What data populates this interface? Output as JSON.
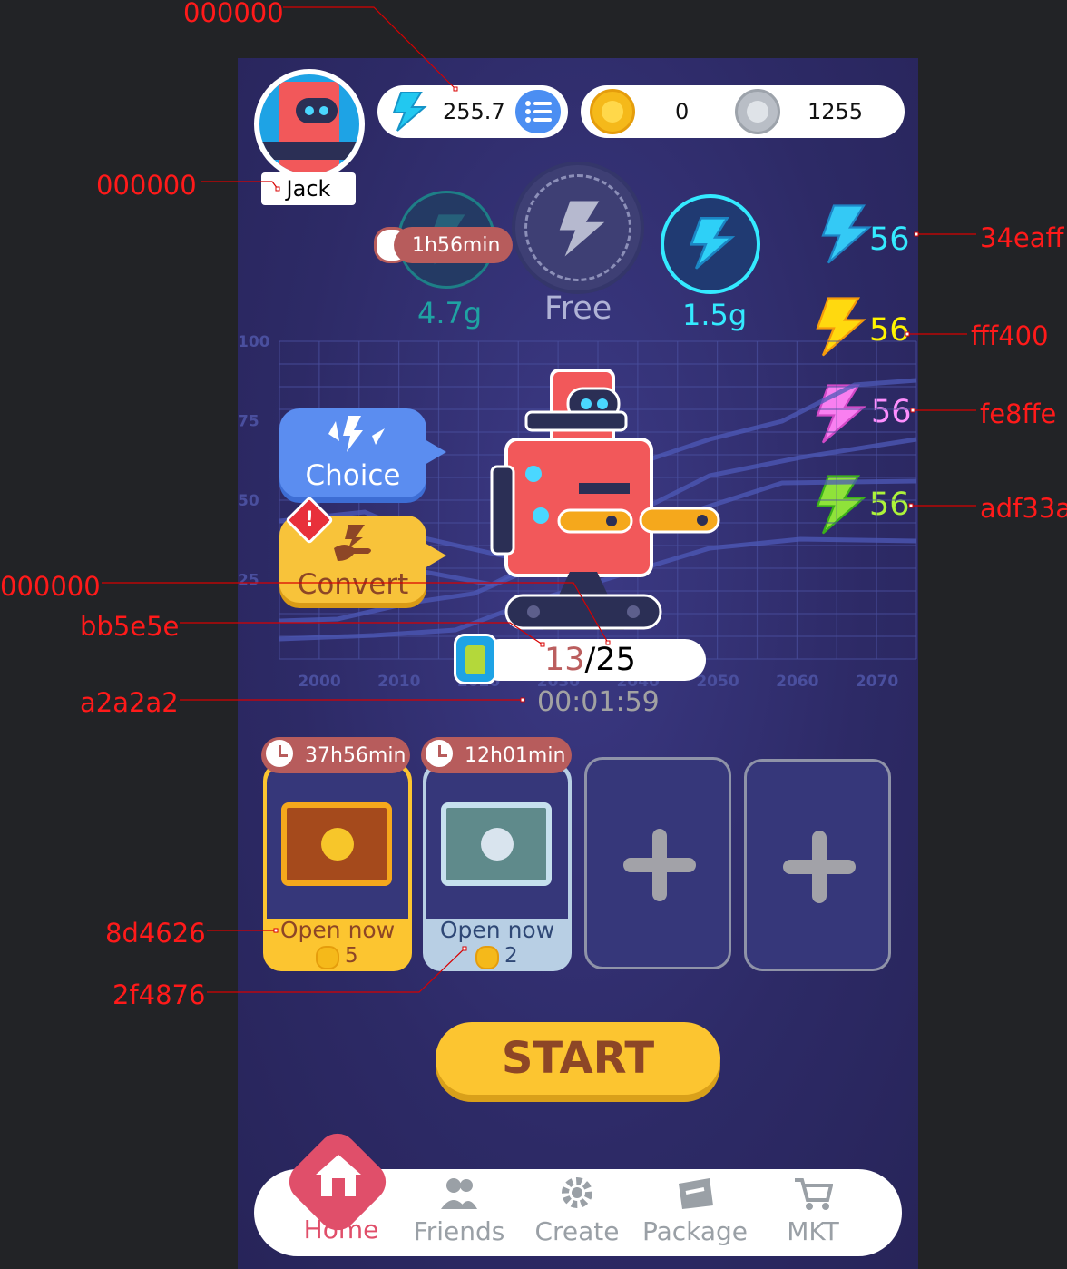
{
  "profile": {
    "name": "Jack"
  },
  "resources": {
    "energy": "255.7",
    "gold": "0",
    "silver": "1255"
  },
  "modes": [
    {
      "label": "4.7g",
      "timer": "1h56min",
      "color": "#1fa3a3"
    },
    {
      "label": "Free",
      "color": "#b0b3d6"
    },
    {
      "label": "1.5g",
      "color": "#34eaff"
    }
  ],
  "gems": [
    {
      "value": "56",
      "color": "#34eaff"
    },
    {
      "value": "56",
      "color": "#fff400"
    },
    {
      "value": "56",
      "color": "#fe8ffe"
    },
    {
      "value": "56",
      "color": "#adf33a"
    }
  ],
  "chart_data": {
    "type": "line",
    "x": [
      "2000",
      "2010",
      "2020",
      "2030",
      "2040",
      "2050",
      "2060",
      "2070"
    ],
    "yticks": [
      "100",
      "75",
      "50",
      "25"
    ],
    "ylim": [
      0,
      100
    ],
    "grid": true
  },
  "actions": {
    "choice": "Choice",
    "convert": "Convert"
  },
  "battery": {
    "current": "13",
    "separator": "/",
    "max": "25",
    "timer": "00:01:59"
  },
  "chests": [
    {
      "timer": "37h56min",
      "label": "Open now",
      "cost": "5"
    },
    {
      "timer": "12h01min",
      "label": "Open now",
      "cost": "2"
    }
  ],
  "start_label": "START",
  "nav": [
    "Home",
    "Friends",
    "Create",
    "Package",
    "MKT"
  ],
  "annotations": [
    {
      "text": "000000"
    },
    {
      "text": "000000"
    },
    {
      "text": "34eaff"
    },
    {
      "text": "fff400"
    },
    {
      "text": "fe8ffe"
    },
    {
      "text": "adf33a"
    },
    {
      "text": "000000"
    },
    {
      "text": "bb5e5e"
    },
    {
      "text": "a2a2a2"
    },
    {
      "text": "8d4626"
    },
    {
      "text": "2f4876"
    }
  ]
}
